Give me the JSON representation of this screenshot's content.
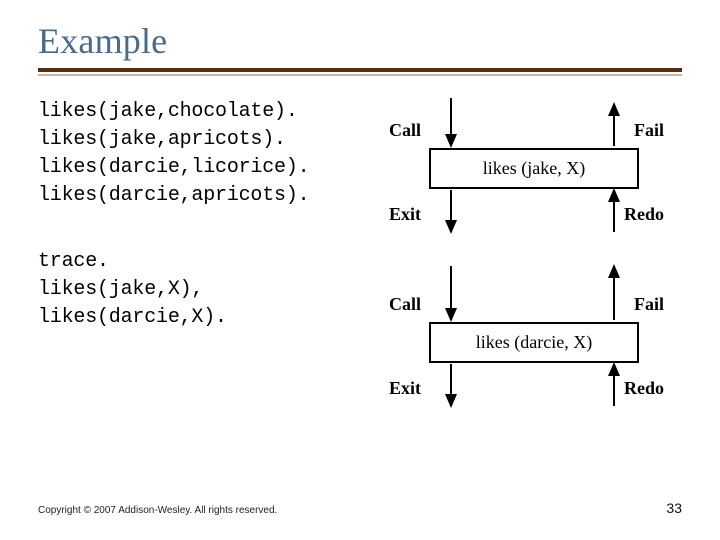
{
  "title": "Example",
  "code": {
    "facts": [
      "likes(jake,chocolate).",
      "likes(jake,apricots).",
      "likes(darcie,licorice).",
      "likes(darcie,apricots)."
    ],
    "queries": [
      "trace.",
      "likes(jake,X),",
      "likes(darcie,X)."
    ]
  },
  "diagram": {
    "box1": "likes (jake, X)",
    "box2": "likes (darcie, X)",
    "labels": {
      "call": "Call",
      "fail": "Fail",
      "exit": "Exit",
      "redo": "Redo"
    }
  },
  "footer": {
    "copyright": "Copyright © 2007 Addison-Wesley. All rights reserved.",
    "page": "33"
  }
}
